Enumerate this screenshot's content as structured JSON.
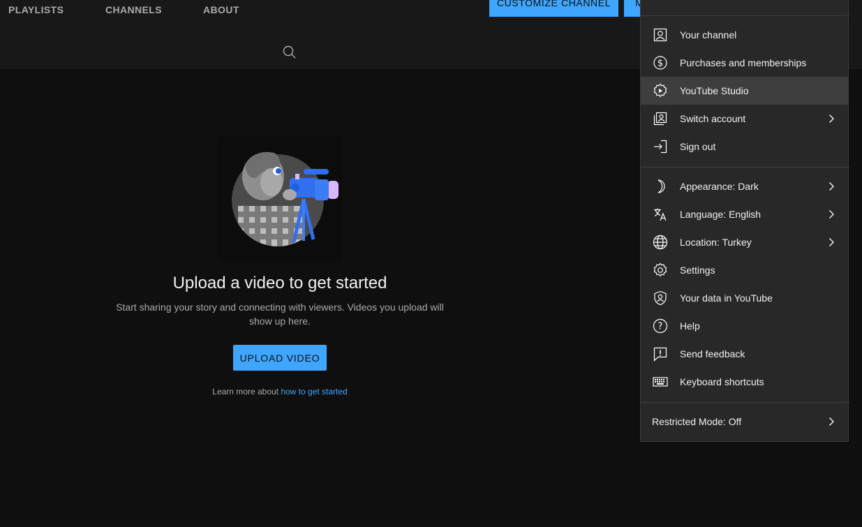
{
  "header": {
    "customize_label": "CUSTOMIZE CHANNEL",
    "manage_label": "M",
    "tabs": [
      {
        "label": "PLAYLISTS"
      },
      {
        "label": "CHANNELS"
      },
      {
        "label": "ABOUT"
      }
    ]
  },
  "empty_state": {
    "title": "Upload a video to get started",
    "description": "Start sharing your story and connecting with viewers. Videos you upload will show up here.",
    "upload_label": "UPLOAD VIDEO",
    "learn_prefix": "Learn more about ",
    "learn_link": "how to get started"
  },
  "menu": {
    "items": [
      {
        "label": "Your channel",
        "icon": "person-icon"
      },
      {
        "label": "Purchases and memberships",
        "icon": "dollar-icon"
      },
      {
        "label": "YouTube Studio",
        "icon": "studio-gear-icon"
      },
      {
        "label": "Switch account",
        "icon": "switch-account-icon"
      },
      {
        "label": "Sign out",
        "icon": "sign-out-icon"
      },
      {
        "label": "Appearance: Dark",
        "icon": "moon-icon"
      },
      {
        "label": "Language: English",
        "icon": "translate-icon"
      },
      {
        "label": "Location: Turkey",
        "icon": "globe-icon"
      },
      {
        "label": "Settings",
        "icon": "gear-icon"
      },
      {
        "label": "Your data in YouTube",
        "icon": "shield-person-icon"
      },
      {
        "label": "Help",
        "icon": "help-icon"
      },
      {
        "label": "Send feedback",
        "icon": "feedback-icon"
      },
      {
        "label": "Keyboard shortcuts",
        "icon": "keyboard-icon"
      },
      {
        "label": "Restricted Mode: Off",
        "icon": ""
      }
    ]
  },
  "colors": {
    "accent": "#3ea6ff",
    "background": "#0f0f0f",
    "menu_bg": "#282828"
  }
}
